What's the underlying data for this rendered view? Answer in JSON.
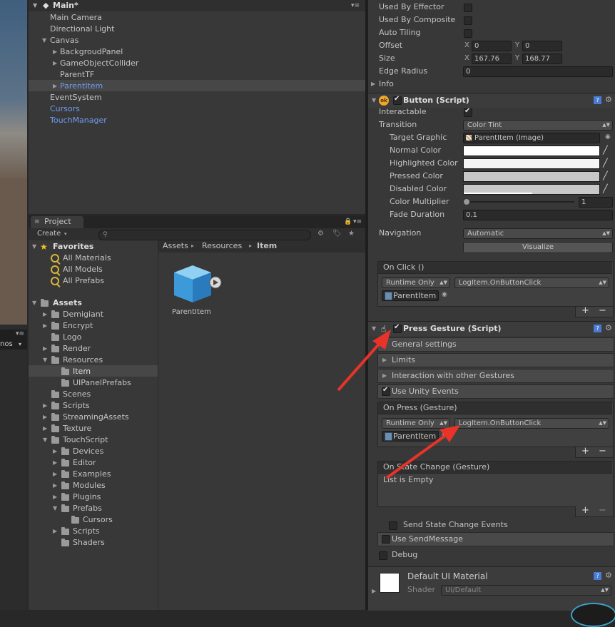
{
  "hierarchy": {
    "scene_name": "Main*",
    "items": [
      {
        "label": "Main Camera"
      },
      {
        "label": "Directional Light"
      },
      {
        "label": "Canvas"
      },
      {
        "label": "BackgroudPanel"
      },
      {
        "label": "GameObjectCollider"
      },
      {
        "label": "ParentTF"
      },
      {
        "label": "ParentItem"
      },
      {
        "label": "EventSystem"
      },
      {
        "label": "Cursors"
      },
      {
        "label": "TouchManager"
      }
    ]
  },
  "scene_toolbar": {
    "label": "nos"
  },
  "project": {
    "tab_label": "Project",
    "create_label": "Create",
    "favorites": {
      "label": "Favorites",
      "items": [
        {
          "label": "All Materials"
        },
        {
          "label": "All Models"
        },
        {
          "label": "All Prefabs"
        }
      ]
    },
    "assets": {
      "label": "Assets",
      "items": [
        {
          "label": "Demigiant"
        },
        {
          "label": "Encrypt"
        },
        {
          "label": "Logo"
        },
        {
          "label": "Render"
        },
        {
          "label": "Resources"
        },
        {
          "label": "Item"
        },
        {
          "label": "UIPanelPrefabs"
        },
        {
          "label": "Scenes"
        },
        {
          "label": "Scripts"
        },
        {
          "label": "StreamingAssets"
        },
        {
          "label": "Texture"
        },
        {
          "label": "TouchScript"
        },
        {
          "label": "Devices"
        },
        {
          "label": "Editor"
        },
        {
          "label": "Examples"
        },
        {
          "label": "Modules"
        },
        {
          "label": "Plugins"
        },
        {
          "label": "Prefabs"
        },
        {
          "label": "Cursors"
        },
        {
          "label": "Scripts"
        },
        {
          "label": "Shaders"
        }
      ]
    },
    "breadcrumb": [
      "Assets",
      "Resources",
      "Item"
    ],
    "asset_name": "ParentItem"
  },
  "inspector": {
    "top_fields": [
      {
        "label": "Used By Effector"
      },
      {
        "label": "Used By Composite"
      },
      {
        "label": "Auto Tiling"
      },
      {
        "label": "Offset",
        "x": "0",
        "y": "0"
      },
      {
        "label": "Size",
        "x": "167.76",
        "y": "168.77"
      },
      {
        "label": "Edge Radius",
        "value": "0"
      },
      {
        "label": "Info"
      }
    ],
    "xy_labels": {
      "x": "X",
      "y": "Y"
    },
    "button": {
      "title": "Button (Script)",
      "interactable_label": "Interactable",
      "transition_label": "Transition",
      "transition_value": "Color Tint",
      "target_graphic_label": "Target Graphic",
      "target_graphic_value": "ParentItem (Image)",
      "normal_color_label": "Normal Color",
      "highlighted_color_label": "Highlighted Color",
      "pressed_color_label": "Pressed Color",
      "disabled_color_label": "Disabled Color",
      "color_multiplier_label": "Color Multiplier",
      "color_multiplier_value": "1",
      "fade_duration_label": "Fade Duration",
      "fade_duration_value": "0.1",
      "navigation_label": "Navigation",
      "navigation_value": "Automatic",
      "visualize_label": "Visualize",
      "on_click_title": "On Click ()",
      "runtime_value": "Runtime Only",
      "function_value": "LogItem.OnButtonClick",
      "object_value": "ParentItem",
      "colors": {
        "normal": "#ffffff",
        "highlighted": "#f5f5f5",
        "pressed": "#c8c8c8",
        "disabled": "#c8c8c8"
      }
    },
    "press_gesture": {
      "title": "Press Gesture (Script)",
      "foldouts": [
        {
          "label": "General settings"
        },
        {
          "label": "Limits"
        },
        {
          "label": "Interaction with other Gestures"
        }
      ],
      "use_unity_events_label": "Use Unity Events",
      "on_press_title": "On Press (Gesture)",
      "runtime_value": "Runtime Only",
      "function_value": "LogItem.OnButtonClick",
      "object_value": "ParentItem",
      "on_state_change_title": "On State Change (Gesture)",
      "list_empty_label": "List is Empty",
      "send_state_change_label": "Send State Change Events",
      "use_send_message_label": "Use SendMessage",
      "debug_label": "Debug"
    },
    "material": {
      "title": "Default UI Material",
      "shader_label": "Shader",
      "shader_value": "UI/Default"
    },
    "list_buttons": {
      "add": "+",
      "remove": "−"
    },
    "accent_color": "#6f9ef2",
    "arrow_color": "#e8332a"
  }
}
